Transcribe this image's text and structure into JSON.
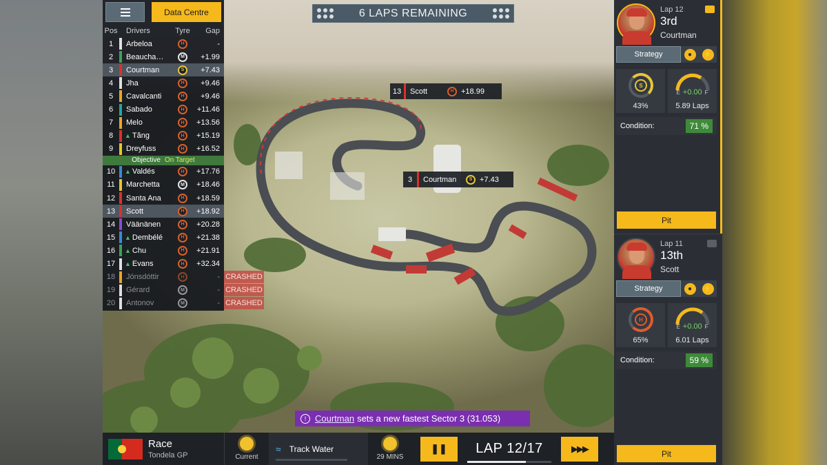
{
  "header": {
    "laps_remaining": "6 LAPS REMAINING",
    "data_centre": "Data Centre"
  },
  "standings": {
    "columns": {
      "pos": "Pos",
      "drivers": "Drivers",
      "tyre": "Tyre",
      "gap": "Gap"
    },
    "rows": [
      {
        "pos": "1",
        "name": "Arbeloa",
        "tyre": "H",
        "gap": "-",
        "color": "#e0e0e0",
        "up": false
      },
      {
        "pos": "2",
        "name": "Beaucha…",
        "tyre": "M",
        "gap": "+1.99",
        "color": "#3aa35a",
        "up": false
      },
      {
        "pos": "3",
        "name": "Courtman",
        "tyre": "S",
        "gap": "+7.43",
        "color": "#d8322c",
        "up": false
      },
      {
        "pos": "4",
        "name": "Jha",
        "tyre": "H",
        "gap": "+9.46",
        "color": "#e0e0e0",
        "up": false
      },
      {
        "pos": "5",
        "name": "Cavalcanti",
        "tyre": "H",
        "gap": "+9.46",
        "color": "#e8a72a",
        "up": false
      },
      {
        "pos": "6",
        "name": "Sabado",
        "tyre": "H",
        "gap": "+11.46",
        "color": "#2aa3a3",
        "up": false
      },
      {
        "pos": "7",
        "name": "Melo",
        "tyre": "H",
        "gap": "+13.56",
        "color": "#e8a72a",
        "up": false
      },
      {
        "pos": "8",
        "name": "Tăng",
        "tyre": "H",
        "gap": "+15.19",
        "color": "#d8322c",
        "up": true
      },
      {
        "pos": "9",
        "name": "Dreyfuss",
        "tyre": "H",
        "gap": "+16.52",
        "color": "#e8c72a",
        "up": false
      },
      {
        "pos": "10",
        "name": "Valdés",
        "tyre": "H",
        "gap": "+17.76",
        "color": "#3a8ad8",
        "up": true
      },
      {
        "pos": "11",
        "name": "Marchetta",
        "tyre": "M",
        "gap": "+18.46",
        "color": "#e8c72a",
        "up": false
      },
      {
        "pos": "12",
        "name": "Santa Ana",
        "tyre": "H",
        "gap": "+18.59",
        "color": "#d8322c",
        "up": false
      },
      {
        "pos": "13",
        "name": "Scott",
        "tyre": "H",
        "gap": "+18.92",
        "color": "#d8322c",
        "up": false
      },
      {
        "pos": "14",
        "name": "Väänänen",
        "tyre": "H",
        "gap": "+20.28",
        "color": "#8a4ad8",
        "up": false
      },
      {
        "pos": "15",
        "name": "Dembélé",
        "tyre": "H",
        "gap": "+21.38",
        "color": "#3a8ad8",
        "up": true
      },
      {
        "pos": "16",
        "name": "Chu",
        "tyre": "H",
        "gap": "+21.91",
        "color": "#3aa35a",
        "up": true
      },
      {
        "pos": "17",
        "name": "Evans",
        "tyre": "H",
        "gap": "+32.34",
        "color": "#e0e0e0",
        "up": true
      },
      {
        "pos": "18",
        "name": "Jónsdóttir",
        "tyre": "H",
        "gap": "-",
        "color": "#e8a72a",
        "up": false,
        "status": "CRASHED"
      },
      {
        "pos": "19",
        "name": "Gérard",
        "tyre": "M",
        "gap": "-",
        "color": "#e0e0e0",
        "up": false,
        "status": "CRASHED"
      },
      {
        "pos": "20",
        "name": "Antonov",
        "tyre": "M",
        "gap": "-",
        "color": "#e0e0e0",
        "up": false,
        "status": "CRASHED"
      }
    ],
    "objective_label": "Objective",
    "objective_status": "On Target"
  },
  "track_tags": [
    {
      "pos": "13",
      "name": "Scott",
      "tyre": "H",
      "gap": "+18.99"
    },
    {
      "pos": "3",
      "name": "Courtman",
      "tyre": "S",
      "gap": "+7.43"
    }
  ],
  "drivers_panel": [
    {
      "lap": "Lap 12",
      "position": "3rd",
      "name": "Courtman",
      "strategy": "Strategy",
      "tyre": "S",
      "tyre_wear": "43%",
      "fuel_delta": "+0.00",
      "fuel_laps": "5.89 Laps",
      "fuel_e": "E",
      "fuel_f": "F",
      "condition_label": "Condition:",
      "condition": "71 %",
      "pit": "Pit"
    },
    {
      "lap": "Lap 11",
      "position": "13th",
      "name": "Scott",
      "strategy": "Strategy",
      "tyre": "H",
      "tyre_wear": "65%",
      "fuel_delta": "+0.00",
      "fuel_laps": "6.01 Laps",
      "fuel_e": "E",
      "fuel_f": "F",
      "condition_label": "Condition:",
      "condition": "59 %",
      "pit": "Pit"
    }
  ],
  "bottom": {
    "event": "Race",
    "venue": "Tondela GP",
    "weather_now": "Current",
    "track_water": "Track Water",
    "weather_next": "29 MINS",
    "lap": "LAP 12/17",
    "lap_progress": 0.7
  },
  "toast": {
    "driver": "Courtman",
    "message": "sets a new fastest Sector 3 (31.053)"
  }
}
